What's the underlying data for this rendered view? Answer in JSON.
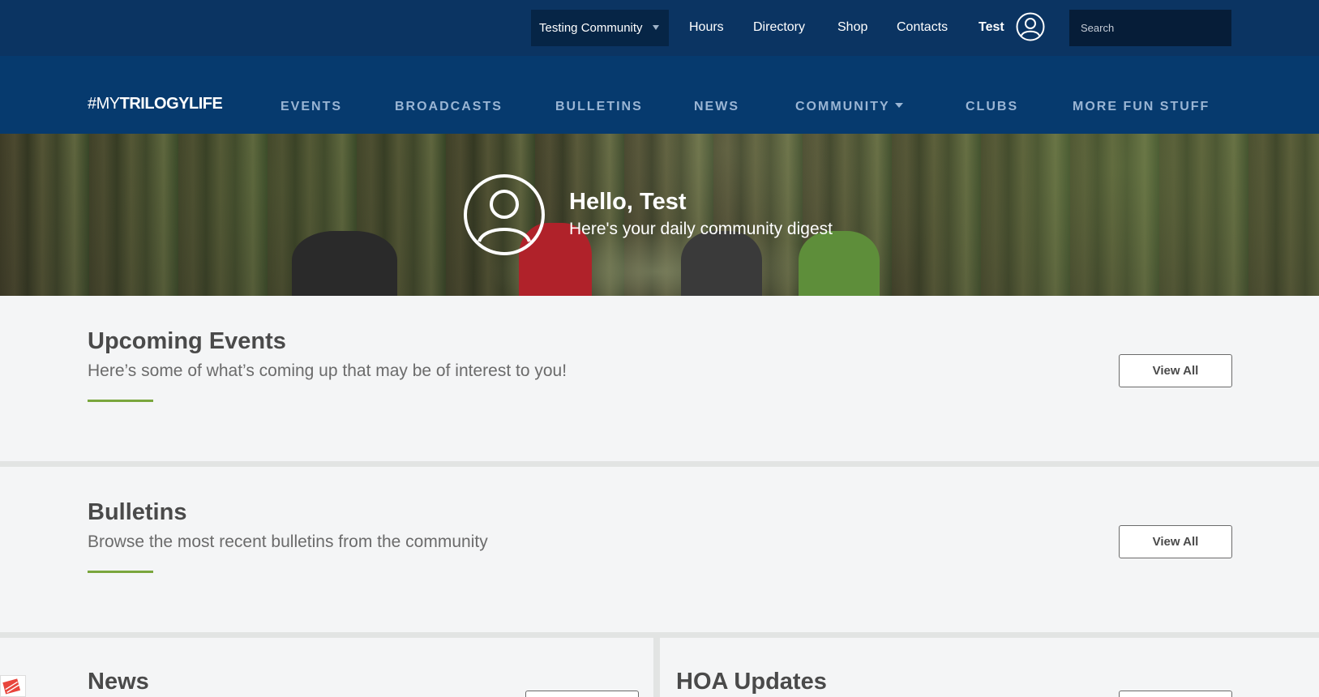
{
  "topbar": {
    "community_select": "Testing Community",
    "links": [
      "Hours",
      "Directory",
      "Shop",
      "Contacts"
    ],
    "user_name": "Test",
    "search_placeholder": "Search"
  },
  "nav": {
    "logo_prefix": "#MY",
    "logo_strong": "TRILOGYLIFE",
    "items": [
      "EVENTS",
      "BROADCASTS",
      "BULLETINS",
      "NEWS",
      "COMMUNITY",
      "CLUBS",
      "MORE FUN STUFF"
    ]
  },
  "hero": {
    "greeting": "Hello, Test",
    "subtitle": "Here's your daily community digest"
  },
  "sections": {
    "events": {
      "title": "Upcoming Events",
      "subtitle": "Here’s some of what’s coming up that may be of interest to you!",
      "button": "View All"
    },
    "bulletins": {
      "title": "Bulletins",
      "subtitle": "Browse the most recent bulletins from the community",
      "button": "View All"
    },
    "news": {
      "title": "News"
    },
    "hoa": {
      "title": "HOA Updates"
    }
  },
  "colors": {
    "topbar": "#0b3462",
    "mainnav": "#063a6e",
    "accent": "#7aa63d"
  }
}
